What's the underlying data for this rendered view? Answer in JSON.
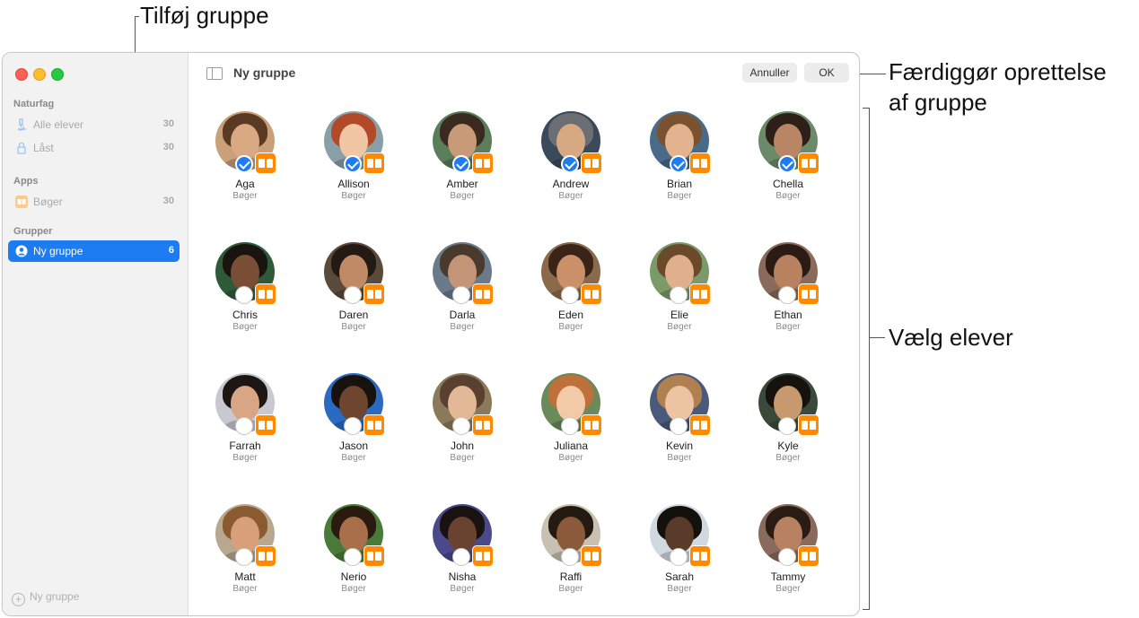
{
  "callouts": {
    "add_group": "Tilføj gruppe",
    "finish_1": "Færdiggør oprettelse",
    "finish_2": "af gruppe",
    "choose_students": "Vælg elever"
  },
  "sidebar": {
    "sections": [
      {
        "title": "Naturfag",
        "items": [
          {
            "label": "Alle elever",
            "count": "30",
            "icon": "microscope-icon"
          },
          {
            "label": "Låst",
            "count": "30",
            "icon": "lock-icon"
          }
        ]
      },
      {
        "title": "Apps",
        "items": [
          {
            "label": "Bøger",
            "count": "30",
            "icon": "books-app-icon"
          }
        ]
      },
      {
        "title": "Grupper",
        "items": [
          {
            "label": "Ny gruppe",
            "count": "6",
            "icon": "group-icon",
            "selected": true
          }
        ]
      }
    ],
    "add_group_label": "Ny gruppe"
  },
  "toolbar": {
    "title": "Ny gruppe",
    "cancel_label": "Annuller",
    "ok_label": "OK"
  },
  "students": [
    {
      "name": "Aga",
      "app": "Bøger",
      "selected": true
    },
    {
      "name": "Allison",
      "app": "Bøger",
      "selected": true
    },
    {
      "name": "Amber",
      "app": "Bøger",
      "selected": true
    },
    {
      "name": "Andrew",
      "app": "Bøger",
      "selected": true
    },
    {
      "name": "Brian",
      "app": "Bøger",
      "selected": true
    },
    {
      "name": "Chella",
      "app": "Bøger",
      "selected": true
    },
    {
      "name": "Chris",
      "app": "Bøger",
      "selected": false
    },
    {
      "name": "Daren",
      "app": "Bøger",
      "selected": false
    },
    {
      "name": "Darla",
      "app": "Bøger",
      "selected": false
    },
    {
      "name": "Eden",
      "app": "Bøger",
      "selected": false
    },
    {
      "name": "Elie",
      "app": "Bøger",
      "selected": false
    },
    {
      "name": "Ethan",
      "app": "Bøger",
      "selected": false
    },
    {
      "name": "Farrah",
      "app": "Bøger",
      "selected": false
    },
    {
      "name": "Jason",
      "app": "Bøger",
      "selected": false
    },
    {
      "name": "John",
      "app": "Bøger",
      "selected": false
    },
    {
      "name": "Juliana",
      "app": "Bøger",
      "selected": false
    },
    {
      "name": "Kevin",
      "app": "Bøger",
      "selected": false
    },
    {
      "name": "Kyle",
      "app": "Bøger",
      "selected": false
    },
    {
      "name": "Matt",
      "app": "Bøger",
      "selected": false
    },
    {
      "name": "Nerio",
      "app": "Bøger",
      "selected": false
    },
    {
      "name": "Nisha",
      "app": "Bøger",
      "selected": false
    },
    {
      "name": "Raffi",
      "app": "Bøger",
      "selected": false
    },
    {
      "name": "Sarah",
      "app": "Bøger",
      "selected": false
    },
    {
      "name": "Tammy",
      "app": "Bøger",
      "selected": false
    }
  ],
  "colors": {
    "accent": "#1d7cf2",
    "books_badge": "#ff8a00"
  }
}
